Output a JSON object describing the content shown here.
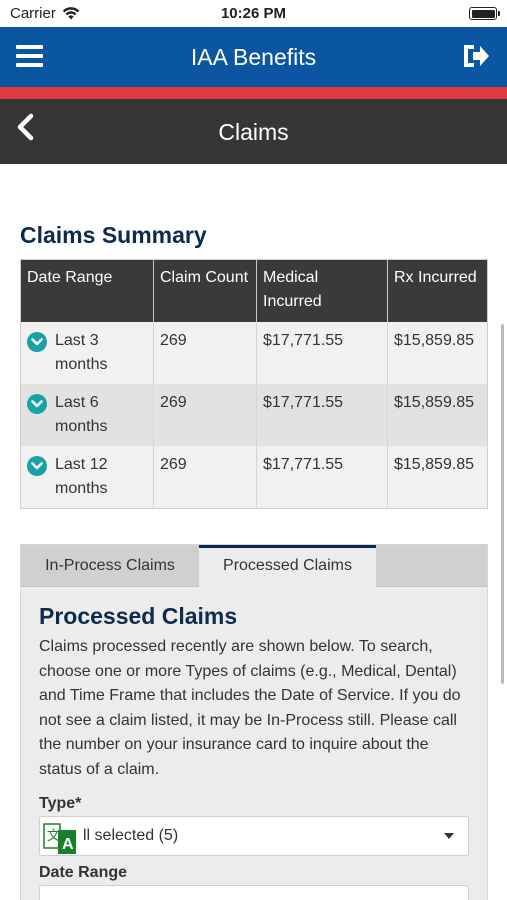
{
  "status_bar": {
    "carrier": "Carrier",
    "time": "10:26 PM"
  },
  "app_bar": {
    "title": "IAA Benefits",
    "menu_icon": "hamburger-menu-icon",
    "logout_icon": "logout-icon"
  },
  "sub_bar": {
    "title": "Claims",
    "back_icon": "chevron-left-icon"
  },
  "summary": {
    "title": "Claims Summary",
    "headers": {
      "range": "Date Range",
      "count": "Claim Count",
      "medical": "Medical Incurred",
      "rx": "Rx Incurred"
    },
    "rows": [
      {
        "range": "Last 3 months",
        "count": "269",
        "medical": "$17,771.55",
        "rx": "$15,859.85"
      },
      {
        "range": "Last 6 months",
        "count": "269",
        "medical": "$17,771.55",
        "rx": "$15,859.85"
      },
      {
        "range": "Last 12 months",
        "count": "269",
        "medical": "$17,771.55",
        "rx": "$15,859.85"
      }
    ]
  },
  "tabs": {
    "in_process": "In-Process Claims",
    "processed": "Processed Claims"
  },
  "panel": {
    "title": "Processed Claims",
    "description": "Claims processed recently are shown below. To search, choose one or more Types of claims (e.g., Medical, Dental) and Time Frame that includes the Date of Service. If you do not see a claim listed, it may be In-Process still. Please call the number on your insurance card to inquire about the status of a claim.",
    "type_label": "Type*",
    "type_value": "ll selected (5)",
    "date_range_label": "Date Range"
  },
  "colors": {
    "app_bar": "#0b56a0",
    "accent_strip": "#e03a3e",
    "sub_bar": "#363636",
    "heading": "#0e2a4d",
    "chevron": "#17a3a5"
  }
}
